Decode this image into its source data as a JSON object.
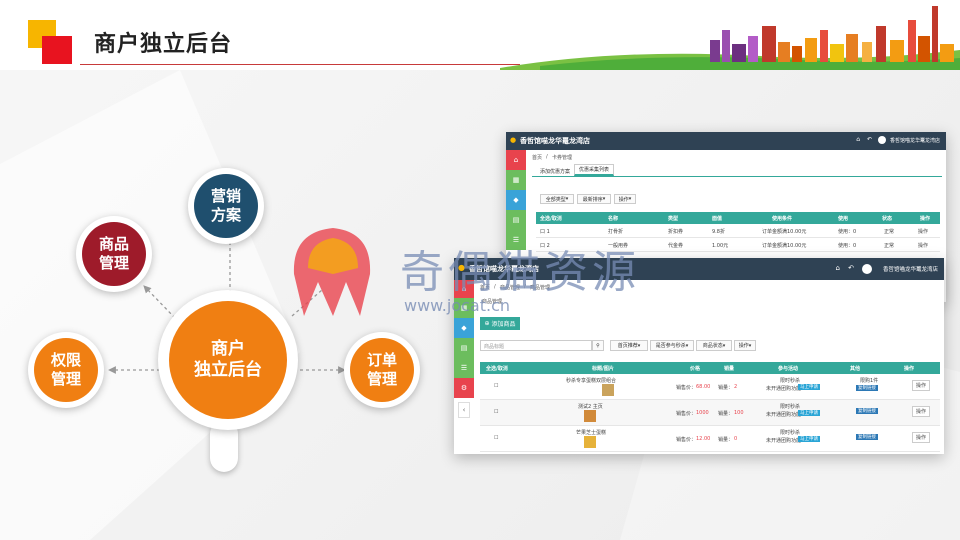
{
  "header": {
    "title": "商户独立后台"
  },
  "diagram": {
    "center": {
      "line1": "商户",
      "line2": "独立后台",
      "color": "#f07f12"
    },
    "nodes": [
      {
        "id": "marketing",
        "line1": "营销",
        "line2": "方案",
        "color": "#1f4f6e"
      },
      {
        "id": "goods",
        "line1": "商品",
        "line2": "管理",
        "color": "#9e1b2a"
      },
      {
        "id": "permission",
        "line1": "权限",
        "line2": "管理",
        "color": "#f07f12"
      },
      {
        "id": "orders",
        "line1": "订单",
        "line2": "管理",
        "color": "#f07f12"
      }
    ]
  },
  "watermark": {
    "text": "奇偶猫资源",
    "url": "www.jocat.cn"
  },
  "window_back": {
    "store_name": "香哲馆喵龙华鼍龙湾店",
    "user_name": "香哲馆喵龙华鼍龙湾店",
    "breadcrumb": [
      "首页",
      "卡券管理"
    ],
    "tabs": [
      "添加优惠方案",
      "优惠采集列表"
    ],
    "filters": [
      "全部类型",
      "最新排序",
      "操作"
    ],
    "columns": [
      "全选/取消",
      "名称",
      "类型",
      "面值",
      "使用条件",
      "使用",
      "状态",
      "操作"
    ],
    "rows": [
      {
        "select": "口 1",
        "name": "打骨折",
        "type": "折扣券",
        "value": "9.8折",
        "condition": "订单金额满10.00元",
        "used": "使用：0",
        "status": "正常",
        "action": "操作"
      },
      {
        "select": "口 2",
        "name": "一般用券",
        "type": "代金券",
        "value": "1.00元",
        "condition": "订单金额满10.00元",
        "used": "使用：0",
        "status": "正常",
        "action": "操作"
      }
    ]
  },
  "window_front": {
    "store_name": "香哲馆喵龙华鼍龙湾店",
    "user_name": "香哲馆喵龙华鼍龙湾店",
    "breadcrumb": [
      "首页",
      "商品管理",
      "商品管理"
    ],
    "section_label": "商品管理",
    "add_button": "添加商品",
    "search_placeholder": "商品标题",
    "filters": [
      "首页推荐",
      "是否参与秒杀",
      "商品状态",
      "操作"
    ],
    "columns": [
      "全选/取消",
      "标题/图片",
      "价格",
      "销量",
      "参与活动",
      "其他",
      "操作"
    ],
    "rows": [
      {
        "title": "秒杀专享蛋糕双层组合",
        "price_label": "销售价：",
        "price": "68.00",
        "sales_label": "销量：",
        "sales": "2",
        "activity1": "限时秒杀",
        "activity2": "未开通团购功能",
        "tag_blue": "马上申请",
        "tag_other1": "复制链接",
        "tag_other2": "",
        "action": "操作"
      },
      {
        "title": "测试2 主页",
        "price_label": "销售价：",
        "price": "1000",
        "sales_label": "销量：",
        "sales": "100",
        "activity1": "限时秒杀",
        "activity2": "未开通团购功能",
        "tag_blue": "马上申请",
        "tag_other1": "复制链接",
        "tag_other2": "",
        "action": "操作"
      },
      {
        "title": "芒果芝士蛋糕",
        "price_label": "销售价：",
        "price": "12.00",
        "sales_label": "销量：",
        "sales": "0",
        "activity1": "限时秒杀",
        "activity2": "未开通团购功能",
        "tag_blue": "马上申请",
        "tag_other1": "复制链接",
        "tag_other2": "",
        "action": "操作"
      }
    ],
    "first_row_other": "限购1件"
  }
}
